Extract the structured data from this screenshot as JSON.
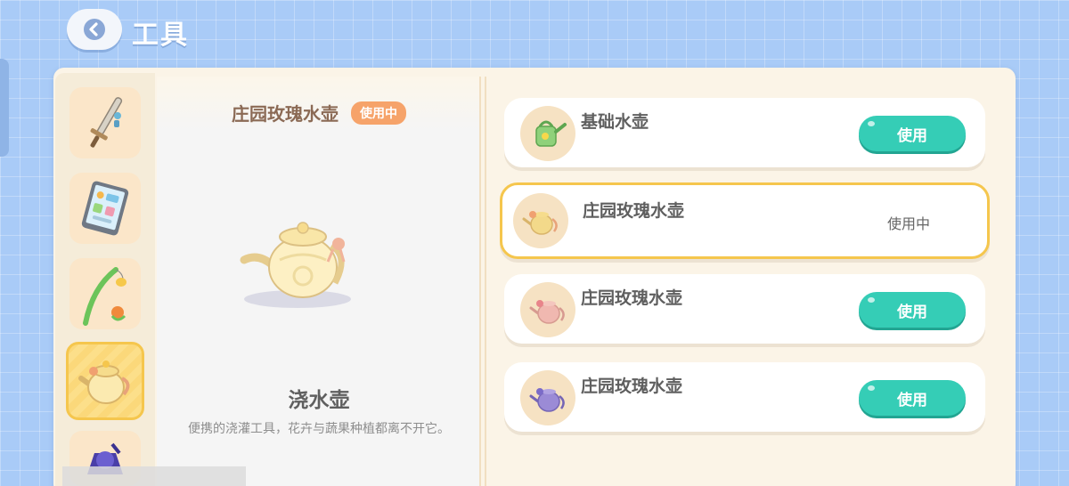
{
  "header": {
    "title": "工具"
  },
  "sidebar": {
    "categories": [
      {
        "name": "sword"
      },
      {
        "name": "tablet"
      },
      {
        "name": "fishing-rod"
      },
      {
        "name": "watering-can",
        "active": true
      },
      {
        "name": "net"
      }
    ]
  },
  "detail": {
    "name": "庄园玫瑰水壶",
    "badge": "使用中",
    "item_type": "浇水壶",
    "description": "便携的浇灌工具，花卉与蔬果种植都离不开它。"
  },
  "list": {
    "items": [
      {
        "name": "基础水壶",
        "action": "使用",
        "equipped": false,
        "color": "#8fd17a"
      },
      {
        "name": "庄园玫瑰水壶",
        "status": "使用中",
        "equipped": true,
        "color": "#f3d98a"
      },
      {
        "name": "庄园玫瑰水壶",
        "action": "使用",
        "equipped": false,
        "color": "#f0b8b0"
      },
      {
        "name": "庄园玫瑰水壶",
        "action": "使用",
        "equipped": false,
        "color": "#9b8bd6"
      }
    ]
  },
  "colors": {
    "background": "#a9cbf7",
    "accent_teal": "#35cdb6",
    "badge_orange": "#f6a36a",
    "highlight_yellow": "#f5c64d"
  }
}
